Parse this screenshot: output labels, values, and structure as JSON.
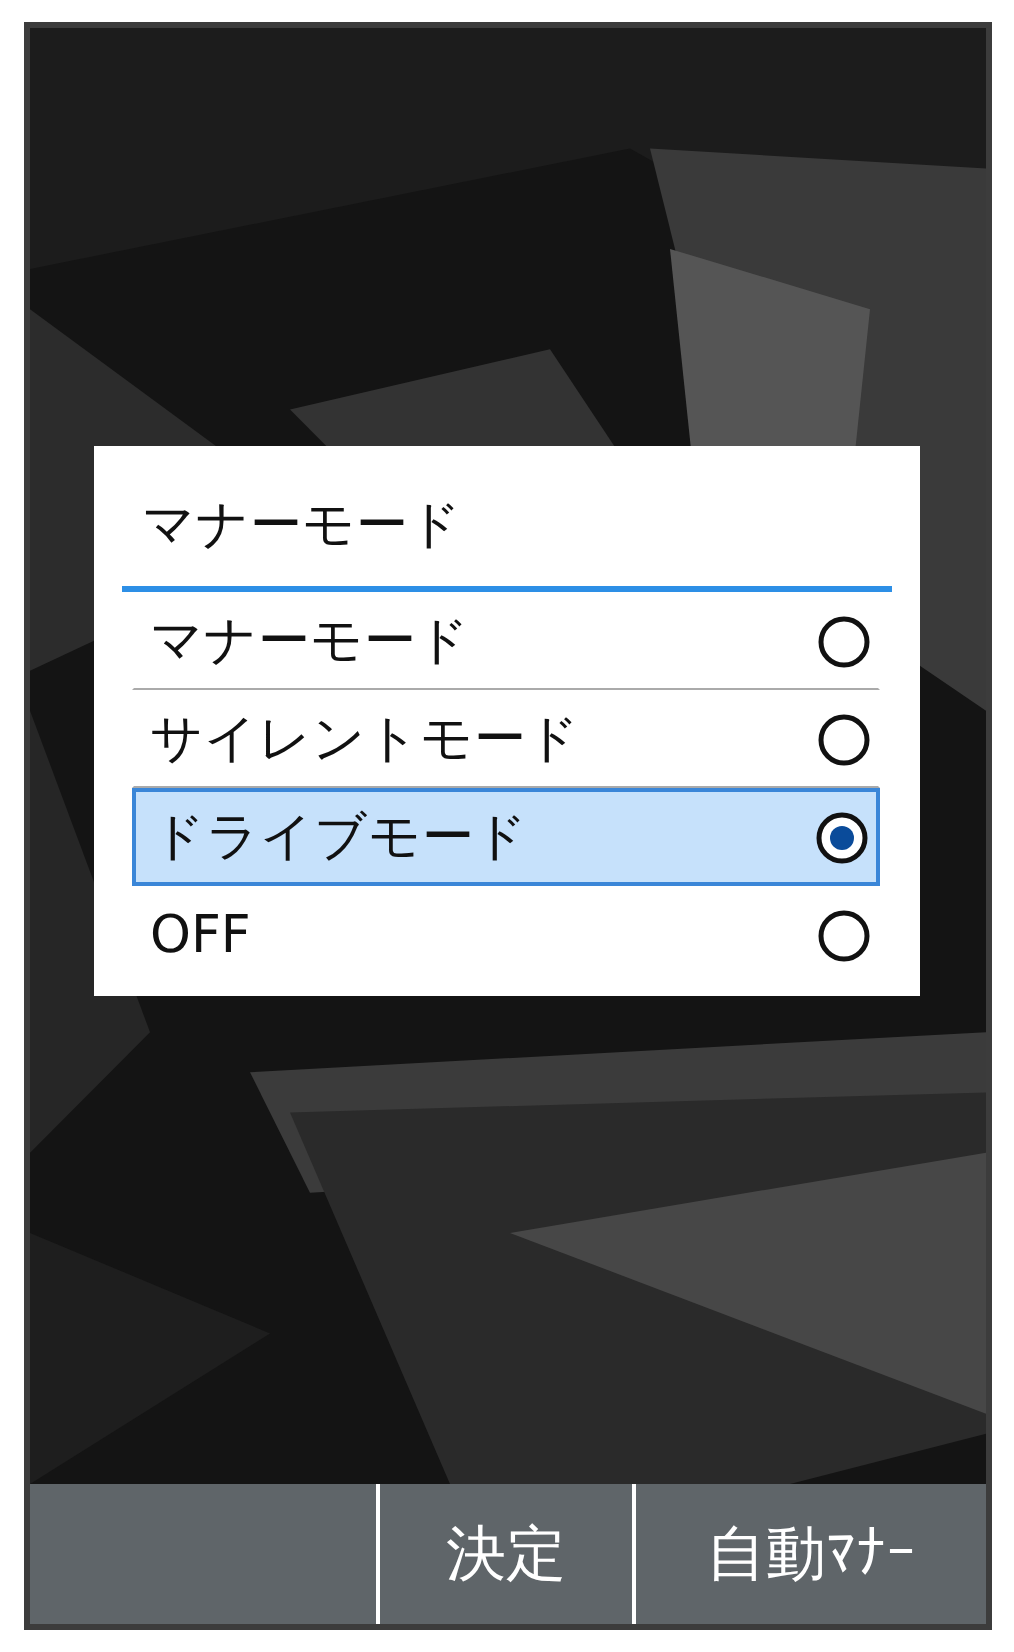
{
  "dialog": {
    "title": "マナーモード",
    "options": [
      {
        "label": "マナーモード",
        "selected": false
      },
      {
        "label": "サイレントモード",
        "selected": false
      },
      {
        "label": "ドライブモード",
        "selected": true
      },
      {
        "label": "OFF",
        "selected": false
      }
    ]
  },
  "softkeys": [
    "決定",
    "自動ﾏﾅｰ"
  ]
}
